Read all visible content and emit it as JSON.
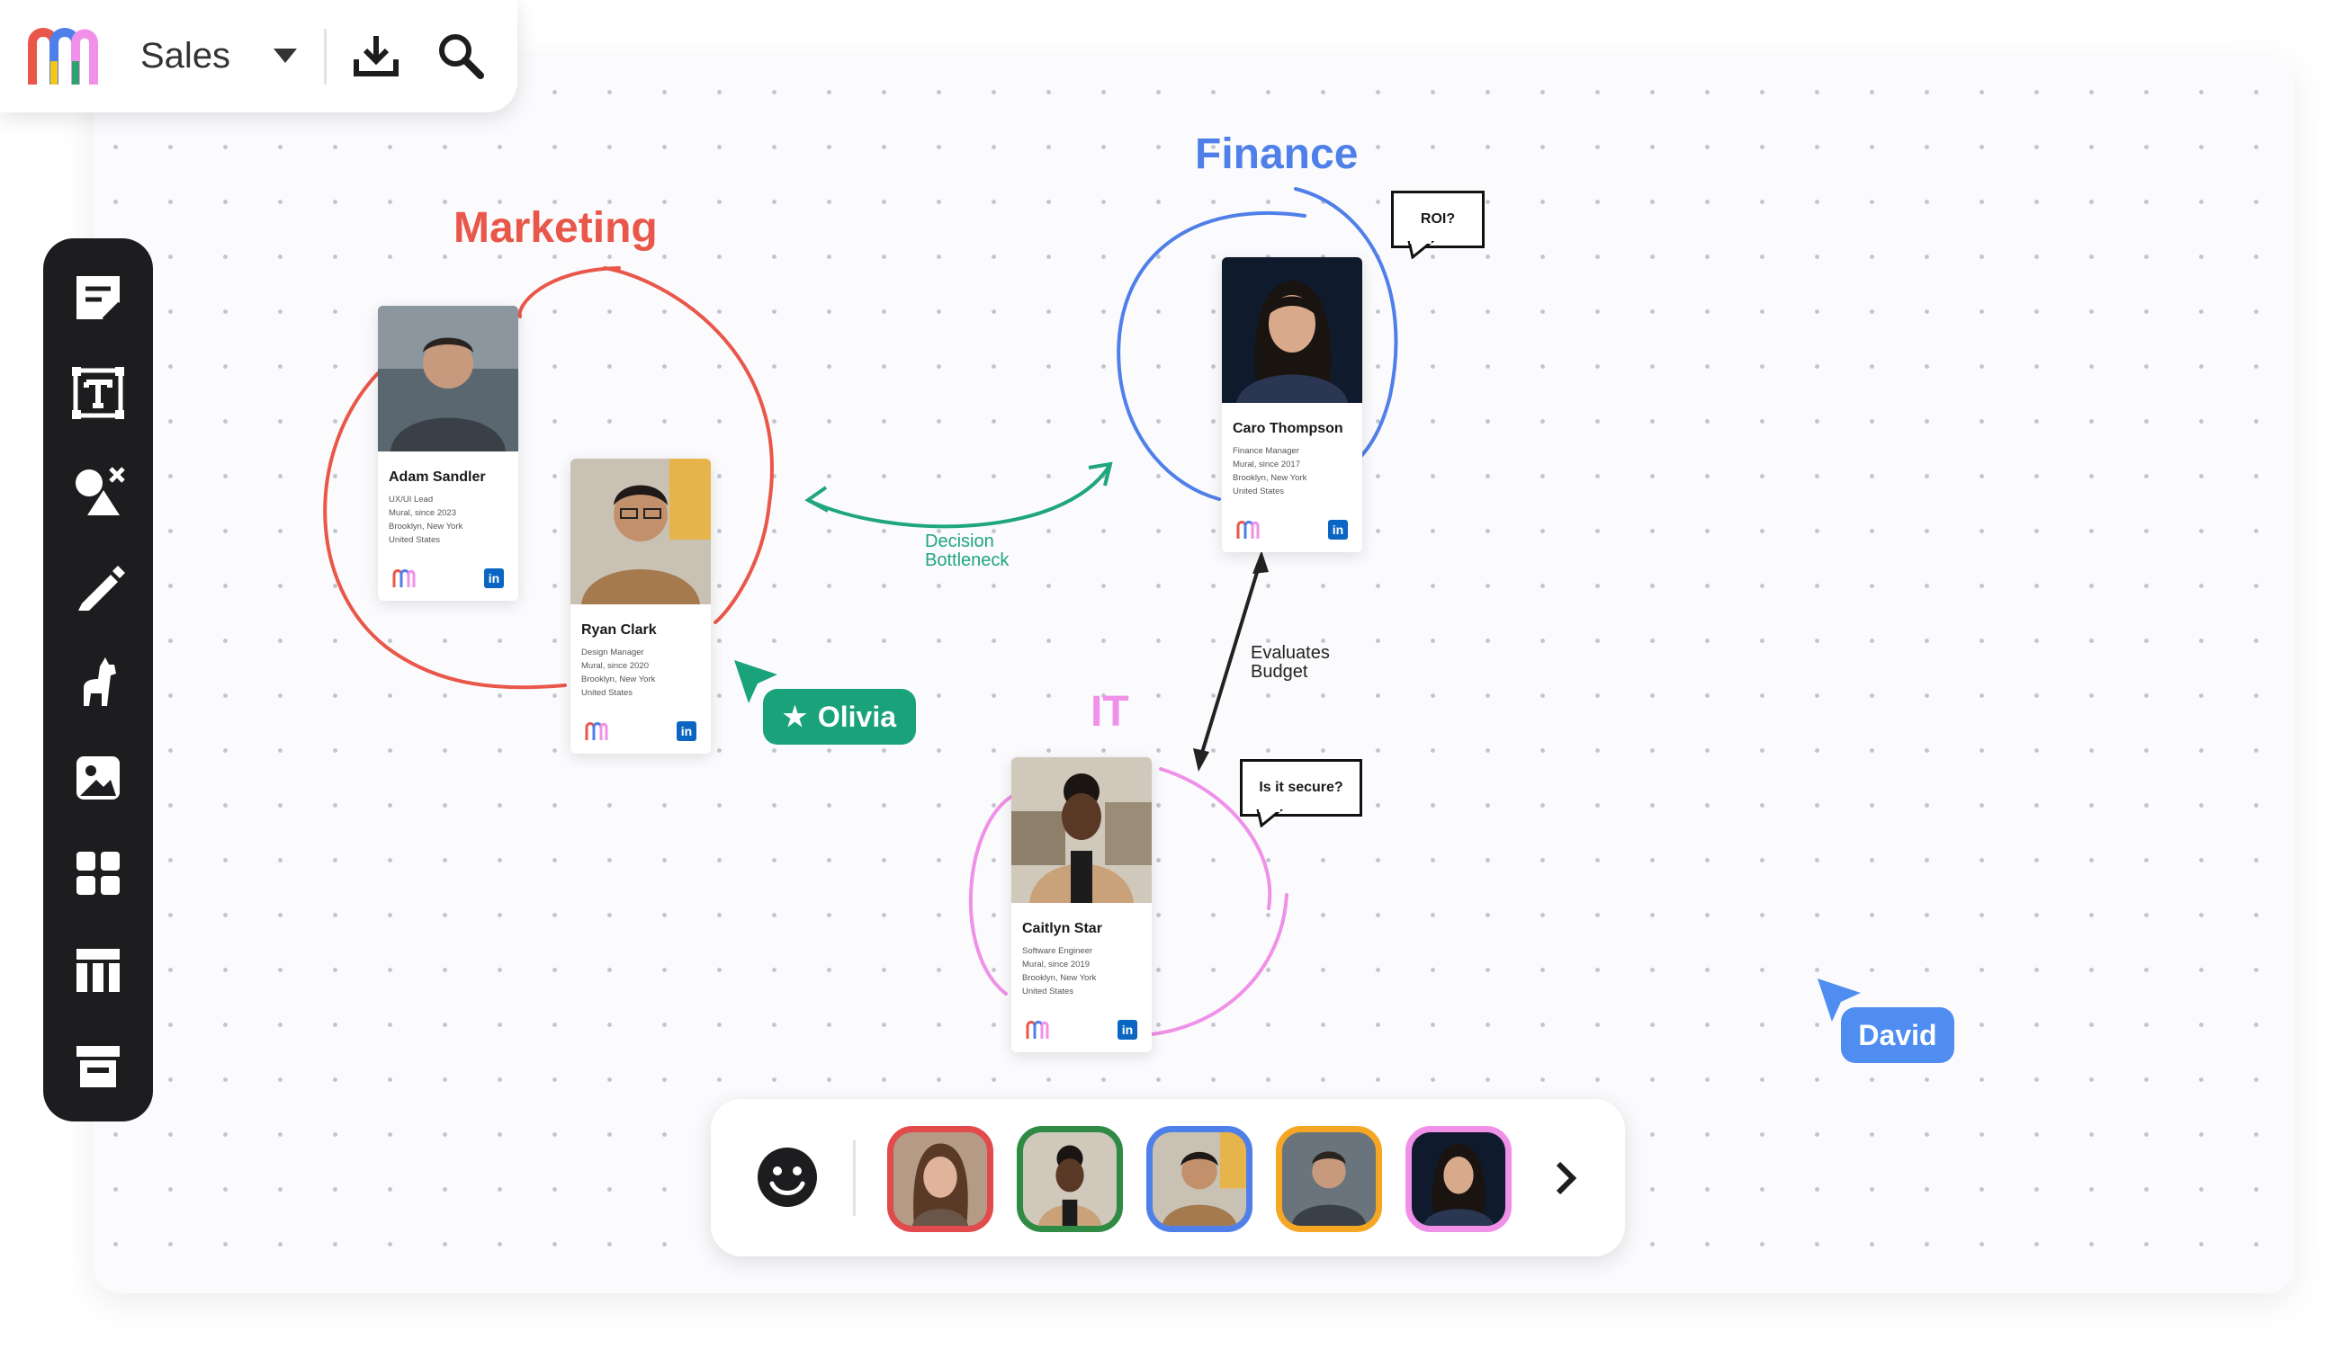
{
  "header": {
    "board_name": "Sales",
    "icons": [
      "mural-logo-icon",
      "chevron-down-icon",
      "download-icon",
      "search-icon"
    ]
  },
  "toolbar": {
    "tools": [
      "sticky-note-icon",
      "text-icon",
      "shapes-icon",
      "pen-icon",
      "llama-icon",
      "image-icon",
      "templates-icon",
      "table-icon",
      "archive-icon"
    ]
  },
  "groups": {
    "marketing": {
      "label": "Marketing",
      "color": "#e9574a"
    },
    "finance": {
      "label": "Finance",
      "color": "#4f7fe8"
    },
    "it": {
      "label": "IT",
      "color": "#f090e8"
    }
  },
  "cards": [
    {
      "name": "Adam Sandler",
      "lines": [
        "UX/UI Lead",
        "Mural, since 2023",
        "Brooklyn, New York",
        "United States"
      ]
    },
    {
      "name": "Ryan Clark",
      "lines": [
        "Design Manager",
        "Mural, since 2020",
        "Brooklyn, New York",
        "United States"
      ]
    },
    {
      "name": "Caro Thompson",
      "lines": [
        "Finance Manager",
        "Mural, since 2017",
        "Brooklyn, New York",
        "United States"
      ]
    },
    {
      "name": "Caitlyn Star",
      "lines": [
        "Software Engineer",
        "Mural, since 2019",
        "Brooklyn, New York",
        "United States"
      ]
    }
  ],
  "connectors": {
    "decision": {
      "line1": "Decision",
      "line2": "Bottleneck",
      "color": "#1fa67a"
    },
    "budget": {
      "line1": "Evaluates",
      "line2": "Budget"
    }
  },
  "bubbles": {
    "roi": "ROI?",
    "secure": "Is it secure?"
  },
  "cursors": {
    "olivia": {
      "name": "Olivia",
      "color": "#1aa37a"
    },
    "david": {
      "name": "David",
      "color": "#4f8ef0"
    }
  },
  "bottombar": {
    "reaction_icon": "smiley-icon",
    "avatar_borders": [
      "#e24b4b",
      "#2f8a44",
      "#4f7fe8",
      "#f5a623",
      "#f090e8"
    ],
    "next_icon": "chevron-right-icon"
  }
}
